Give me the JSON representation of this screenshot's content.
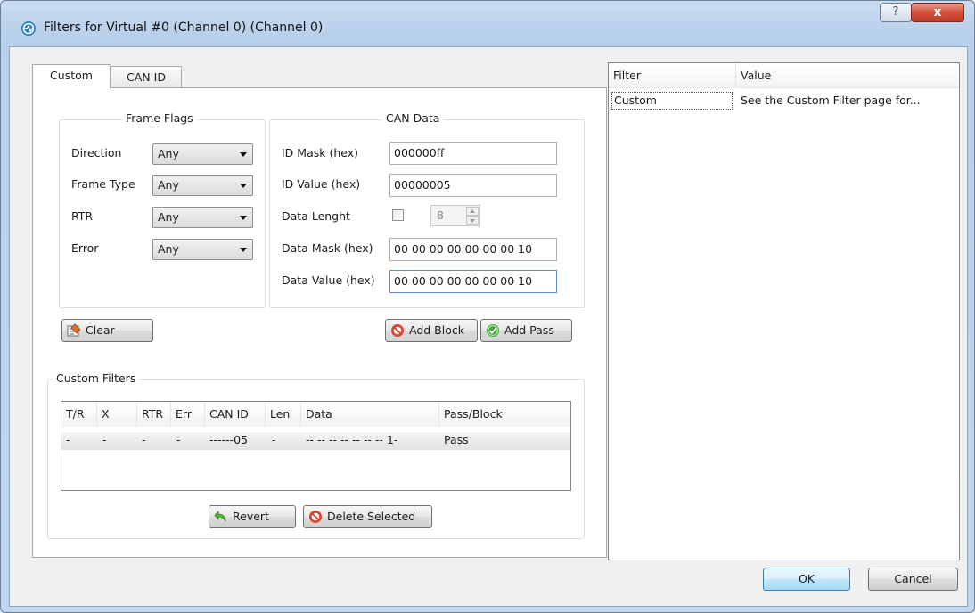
{
  "window": {
    "title": "Filters for Virtual #0 (Channel 0) (Channel 0)",
    "help_label": "?",
    "close_label": "x"
  },
  "tabs": [
    {
      "label": "Custom",
      "active": true
    },
    {
      "label": "CAN ID",
      "active": false
    }
  ],
  "frame_flags": {
    "legend": "Frame Flags",
    "rows": [
      {
        "label": "Direction",
        "value": "Any"
      },
      {
        "label": "Frame Type",
        "value": "Any"
      },
      {
        "label": "RTR",
        "value": "Any"
      },
      {
        "label": "Error",
        "value": "Any"
      }
    ]
  },
  "can_data": {
    "legend": "CAN Data",
    "id_mask_label": "ID Mask (hex)",
    "id_mask_value": "000000ff",
    "id_value_label": "ID Value (hex)",
    "id_value_value": "00000005",
    "data_length_label": "Data Lenght",
    "data_length_checked": false,
    "data_length_value": "8",
    "data_mask_label": "Data Mask (hex)",
    "data_mask_value": "00 00 00 00 00 00 00 10",
    "data_value_label": "Data Value (hex)",
    "data_value_value": "00 00 00 00 00 00 00 10"
  },
  "actions": {
    "clear_label": "Clear",
    "add_block_label": "Add Block",
    "add_pass_label": "Add Pass"
  },
  "custom_filters": {
    "legend": "Custom Filters",
    "columns": [
      "T/R",
      "X",
      "RTR",
      "Err",
      "CAN ID",
      "Len",
      "Data",
      "Pass/Block"
    ],
    "rows": [
      [
        "-",
        "-",
        "-",
        "-",
        "------05",
        "-",
        "-- -- -- -- -- -- -- 1-",
        "Pass"
      ]
    ],
    "revert_label": "Revert",
    "delete_label": "Delete Selected"
  },
  "summary": {
    "columns": [
      "Filter",
      "Value"
    ],
    "rows": [
      [
        "Custom",
        "See the Custom Filter page for..."
      ]
    ]
  },
  "footer": {
    "ok_label": "OK",
    "cancel_label": "Cancel"
  },
  "colors": {
    "window_frame": "#c2d6ee",
    "close_red": "#c23a25",
    "ok_blue": "#a7d9f5"
  }
}
